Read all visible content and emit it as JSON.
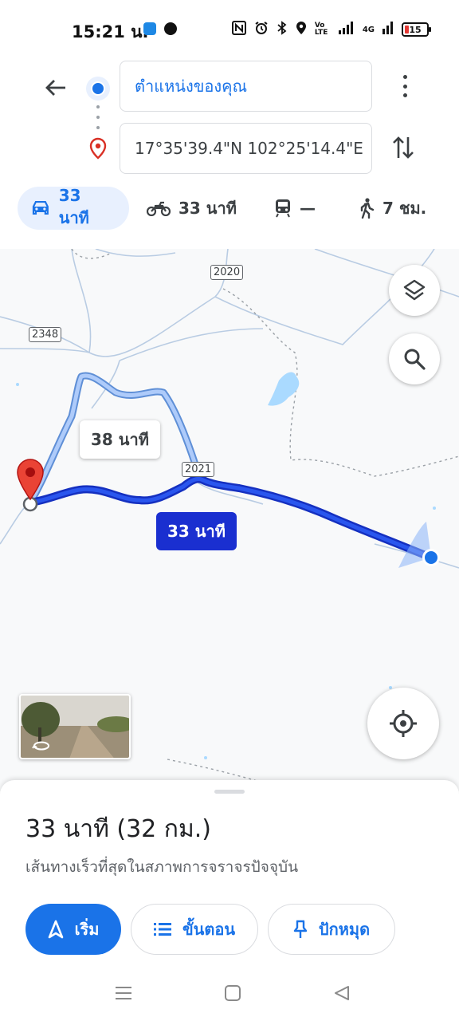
{
  "status_bar": {
    "time": "15:21 น.",
    "network_label": "4G",
    "volte_label": "Vo LTE",
    "battery_level": "15"
  },
  "header": {
    "origin": "ตำแหน่งของคุณ",
    "destination": "17°35'39.4\"N 102°25'14.4\"E",
    "modes": [
      {
        "icon": "car-icon",
        "label": "33 นาที",
        "active": true
      },
      {
        "icon": "motorcycle-icon",
        "label": "33 นาที",
        "active": false
      },
      {
        "icon": "train-icon",
        "label": "—",
        "active": false
      },
      {
        "icon": "walk-icon",
        "label": "7 ชม.",
        "active": false
      }
    ]
  },
  "map": {
    "road_shields": [
      "2020",
      "2348",
      "2021"
    ],
    "alt_route_time": "38 นาที",
    "main_route_time": "33 นาที",
    "colors": {
      "main_route": "#1a2fd0",
      "alt_route": "#8ab4f8",
      "water": "#aadaff",
      "pin": "#ea4335",
      "location_dot": "#1a73e8"
    }
  },
  "bottom_sheet": {
    "summary": "33 นาที (32 กม.)",
    "description": "เส้นทางเร็วที่สุดในสภาพการจราจรปัจจุบัน",
    "buttons": {
      "start": "เริ่ม",
      "steps": "ขั้นตอน",
      "pin": "ปักหมุด"
    }
  }
}
